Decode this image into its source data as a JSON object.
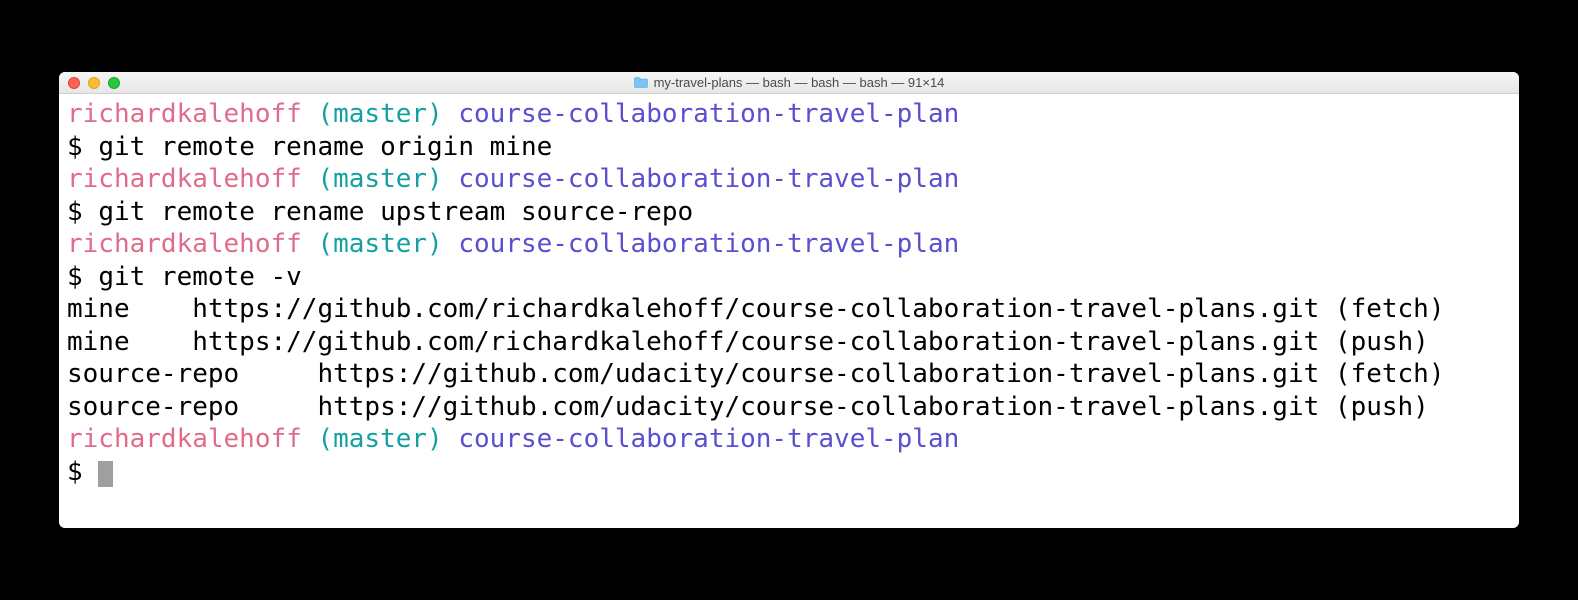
{
  "titlebar": {
    "title": "my-travel-plans — bash — bash — bash — 91×14"
  },
  "prompt": {
    "user": "richardkalehoff",
    "branch": "(master)",
    "dir": "course-collaboration-travel-plan",
    "symbol": "$"
  },
  "commands": {
    "c1": "git remote rename origin mine",
    "c2": "git remote rename upstream source-repo",
    "c3": "git remote -v"
  },
  "output": {
    "l1": "mine    https://github.com/richardkalehoff/course-collaboration-travel-plans.git (fetch)",
    "l2": "mine    https://github.com/richardkalehoff/course-collaboration-travel-plans.git (push)",
    "l3": "source-repo     https://github.com/udacity/course-collaboration-travel-plans.git (fetch)",
    "l4": "source-repo     https://github.com/udacity/course-collaboration-travel-plans.git (push)"
  }
}
